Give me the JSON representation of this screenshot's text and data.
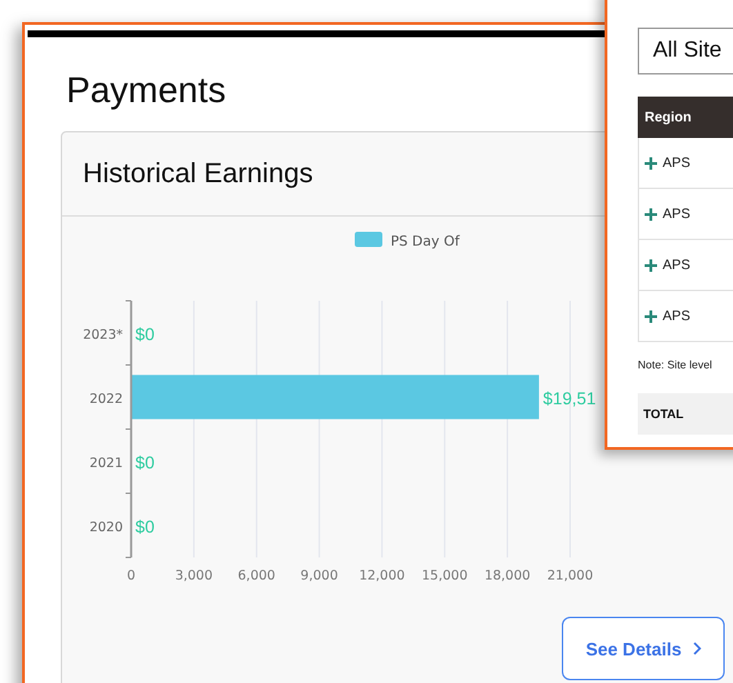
{
  "page": {
    "title": "Payments"
  },
  "earnings_card": {
    "title": "Historical Earnings",
    "chart_data": {
      "type": "bar",
      "orientation": "horizontal",
      "categories": [
        "2023*",
        "2022",
        "2021",
        "2020"
      ],
      "series": [
        {
          "name": "PS Day Of",
          "color": "#5bc8e2",
          "values": [
            0,
            19510,
            0,
            0
          ]
        }
      ],
      "xlim": [
        0,
        21000
      ],
      "grid": true,
      "xticks": [
        {
          "value": 0,
          "label": "0"
        },
        {
          "value": 3000,
          "label": "3,000"
        },
        {
          "value": 6000,
          "label": "6,000"
        },
        {
          "value": 9000,
          "label": "9,000"
        },
        {
          "value": 12000,
          "label": "12,000"
        },
        {
          "value": 15000,
          "label": "15,000"
        },
        {
          "value": 18000,
          "label": "18,000"
        },
        {
          "value": 21000,
          "label": "21,000"
        }
      ],
      "value_labels": [
        "$0",
        "$19,51",
        "$0",
        "$0"
      ]
    },
    "button": "See Details"
  },
  "sites_panel": {
    "dropdown": "All Site",
    "table": {
      "columns": [
        "Region"
      ],
      "rows": [
        {
          "region": "APS",
          "expanded": false
        },
        {
          "region": "APS",
          "expanded": false
        },
        {
          "region": "APS",
          "expanded": false
        },
        {
          "region": "APS",
          "expanded": false
        }
      ]
    },
    "note": "Note: Site level",
    "total": "TOTAL"
  }
}
